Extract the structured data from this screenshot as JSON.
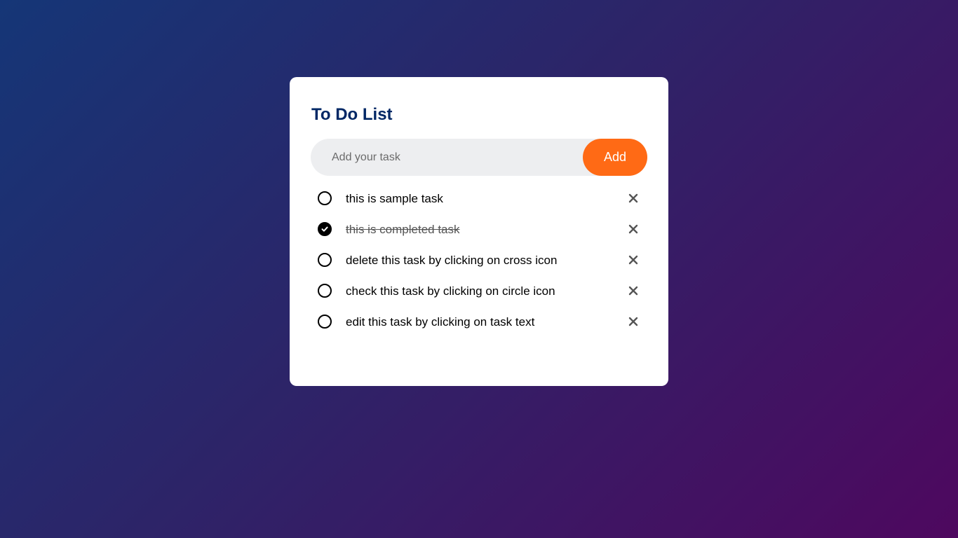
{
  "app": {
    "title": "To Do List"
  },
  "input": {
    "placeholder": "Add your task",
    "value": ""
  },
  "add_button": {
    "label": "Add"
  },
  "tasks": [
    {
      "text": "this is sample task",
      "completed": false
    },
    {
      "text": "this is completed task",
      "completed": true
    },
    {
      "text": "delete this task by clicking on cross icon",
      "completed": false
    },
    {
      "text": "check this task by clicking on circle icon",
      "completed": false
    },
    {
      "text": "edit this task by clicking on task text",
      "completed": false
    }
  ],
  "icons": {
    "unchecked": "circle-icon",
    "checked": "check-circle-icon",
    "delete": "close-icon"
  },
  "colors": {
    "background_start": "#153677",
    "background_end": "#4e085f",
    "title": "#002765",
    "accent": "#ff6a15",
    "input_background": "#edeef0"
  }
}
